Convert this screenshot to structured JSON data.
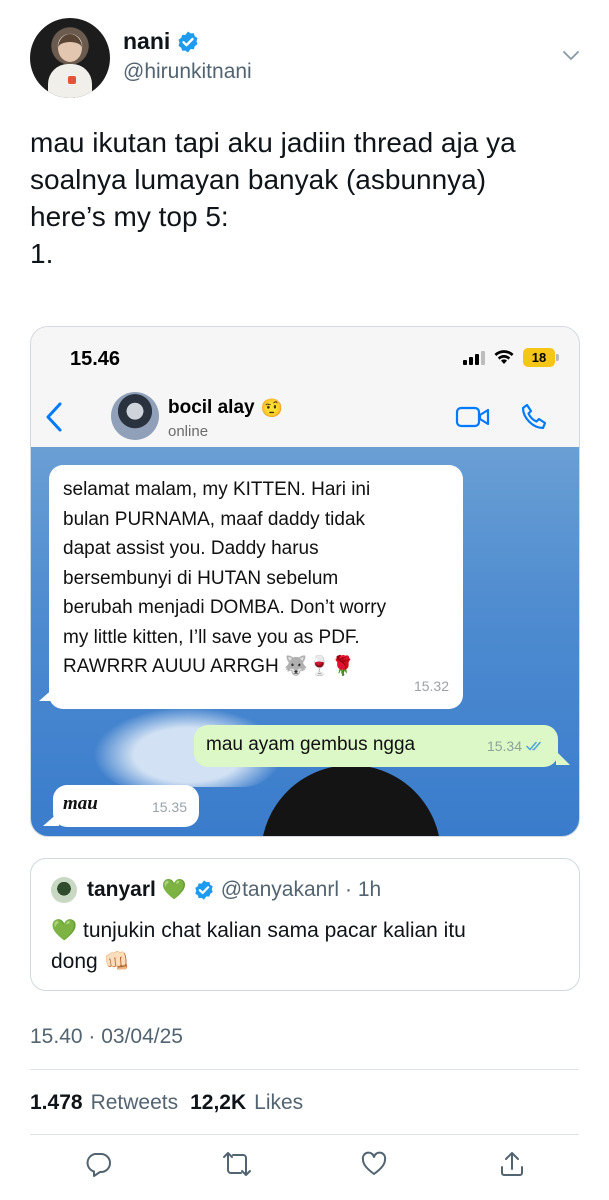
{
  "author": {
    "display_name": "nani",
    "handle": "@hirunkitnani",
    "verified": true
  },
  "tweet_text_lines": [
    "mau ikutan tapi aku jadiin thread aja ya",
    "soalnya lumayan banyak (asbunnya)",
    "here’s my top 5:",
    "1."
  ],
  "screenshot": {
    "status_time": "15.46",
    "battery": "18",
    "contact_name": "bocil alay",
    "contact_emoji": "🤨",
    "contact_status": "online",
    "messages": [
      {
        "direction": "incoming",
        "lines": [
          "selamat malam, my KITTEN. Hari ini",
          "bulan PURNAMA, maaf daddy tidak",
          "dapat assist you. Daddy harus",
          "bersembunyi di HUTAN sebelum",
          "berubah menjadi DOMBA. Don’t worry",
          "my little kitten, I’ll save you as PDF.",
          "RAWRRR AUUU ARRGH 🐺🍷🌹"
        ],
        "time": "15.32"
      },
      {
        "direction": "outgoing",
        "text": "mau ayam gembus ngga",
        "time": "15.34",
        "read": true
      },
      {
        "direction": "incoming",
        "text": "mau",
        "time": "15.35"
      }
    ]
  },
  "quote": {
    "display_name": "tanyarl",
    "name_emoji": "💚",
    "handle": "@tanyakanrl",
    "age": "· 1h",
    "text_line1": "💚 tunjukin chat kalian sama pacar kalian itu",
    "text_line2": "dong 👊🏻"
  },
  "timestamp": "15.40 · 03/04/25",
  "stats": {
    "retweets_count": "1.478",
    "retweets_label": "Retweets",
    "likes_count": "12,2K",
    "likes_label": "Likes"
  },
  "actions": [
    "reply-icon",
    "retweet-icon",
    "like-icon",
    "share-icon"
  ],
  "colors": {
    "verified_blue": "#1d9bf0",
    "secondary_text": "#536471",
    "whatsapp_blue": "#007aff",
    "outgoing_bubble": "#dcf8c6"
  }
}
